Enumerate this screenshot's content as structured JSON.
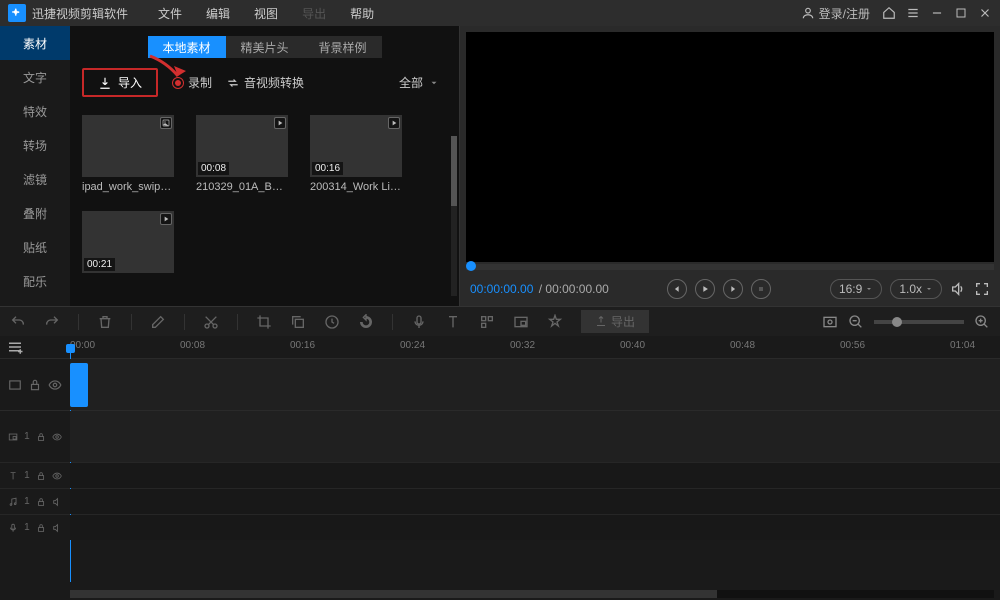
{
  "titlebar": {
    "app_title": "迅捷视频剪辑软件",
    "menu": {
      "file": "文件",
      "edit": "编辑",
      "view": "视图",
      "export": "导出",
      "help": "帮助"
    },
    "login_label": "登录/注册"
  },
  "sidebar": {
    "items": [
      {
        "id": "material",
        "label": "素材"
      },
      {
        "id": "text",
        "label": "文字"
      },
      {
        "id": "effect",
        "label": "特效"
      },
      {
        "id": "transition",
        "label": "转场"
      },
      {
        "id": "filter",
        "label": "滤镜"
      },
      {
        "id": "attach",
        "label": "叠附"
      },
      {
        "id": "sticker",
        "label": "贴纸"
      },
      {
        "id": "music",
        "label": "配乐"
      }
    ]
  },
  "media_tabs": {
    "local": "本地素材",
    "intro": "精美片头",
    "bg": "背景样例"
  },
  "media_toolbar": {
    "import_label": "导入",
    "record_label": "录制",
    "convert_label": "音视频转换",
    "filter_label": "全部"
  },
  "clips": [
    {
      "name": "ipad_work_swipe...",
      "duration": ""
    },
    {
      "name": "210329_01A_Bali_...",
      "duration": "00:08"
    },
    {
      "name": "200314_Work Lif...",
      "duration": "00:16"
    },
    {
      "name": "",
      "duration": "00:21"
    }
  ],
  "preview": {
    "time_current": "00:00:00.00",
    "time_total": "00:00:00.00",
    "aspect_label": "16:9",
    "speed_label": "1.0x"
  },
  "toolbar": {
    "export_label": "导出"
  },
  "timeline": {
    "ticks": [
      "00:00",
      "00:08",
      "00:16",
      "00:24",
      "00:32",
      "00:40",
      "00:48",
      "00:56",
      "01:04"
    ]
  }
}
